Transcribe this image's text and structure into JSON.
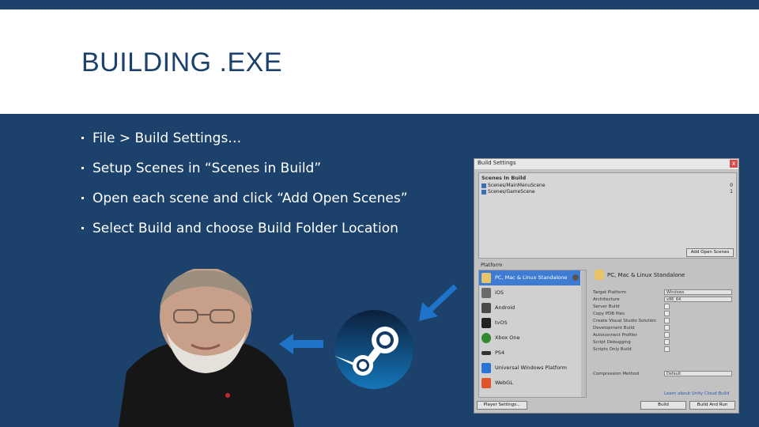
{
  "slide": {
    "title": "BUILDING .EXE",
    "bullets": [
      "File > Build Settings…",
      "Setup Scenes in “Scenes in Build”",
      "Open each scene and click “Add Open Scenes”",
      "Select Build and choose Build Folder Location"
    ]
  },
  "build_settings": {
    "window_title": "Build Settings",
    "close_glyph": "x",
    "scenes_header": "Scenes In Build",
    "scenes": [
      {
        "name": "Scenes/MainMenuScene",
        "index": "0"
      },
      {
        "name": "Scenes/GameScene",
        "index": "1"
      }
    ],
    "add_open_scenes": "Add Open Scenes",
    "platform_header": "Platform",
    "platforms": [
      "PC, Mac & Linux Standalone",
      "iOS",
      "Android",
      "tvOS",
      "Xbox One",
      "PS4",
      "Universal Windows Platform",
      "WebGL"
    ],
    "selected_platform_title": "PC, Mac & Linux Standalone",
    "options": [
      {
        "label": "Target Platform",
        "value": "Windows",
        "type": "select"
      },
      {
        "label": "Architecture",
        "value": "x86_64",
        "type": "select"
      },
      {
        "label": "Server Build",
        "type": "check"
      },
      {
        "label": "Copy PDB files",
        "type": "check"
      },
      {
        "label": "Create Visual Studio Solution",
        "type": "check"
      },
      {
        "label": "Development Build",
        "type": "check"
      },
      {
        "label": "Autoconnect Profiler",
        "type": "check"
      },
      {
        "label": "Script Debugging",
        "type": "check"
      },
      {
        "label": "Scripts Only Build",
        "type": "check"
      }
    ],
    "compression_label": "Compression Method",
    "compression_value": "Default",
    "cloud_build_link": "Learn about Unity Cloud Build",
    "player_settings": "Player Settings...",
    "build": "Build",
    "build_and_run": "Build And Run"
  },
  "colors": {
    "background": "#1c416b",
    "title_band": "#ffffff",
    "title_text": "#1c416b",
    "arrow": "#1f73c9",
    "selected_platform": "#3e7bd2"
  },
  "icons": {
    "steam": "steam-logo-icon",
    "arrow_left": "arrow-left-icon",
    "arrow_diag": "arrow-down-left-icon"
  }
}
